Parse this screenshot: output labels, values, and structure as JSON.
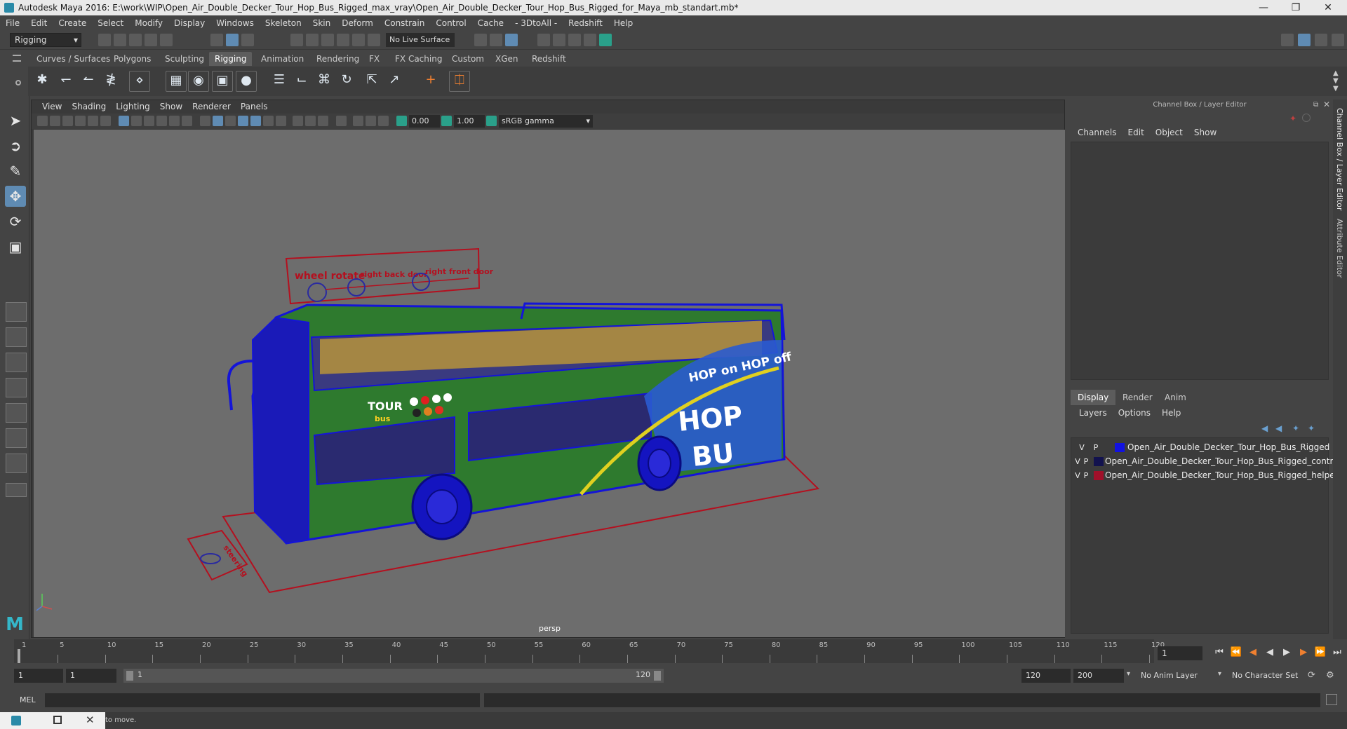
{
  "window": {
    "title": "Autodesk Maya 2016: E:\\work\\WIP\\Open_Air_Double_Decker_Tour_Hop_Bus_Rigged_max_vray\\Open_Air_Double_Decker_Tour_Hop_Bus_Rigged_for_Maya_mb_standart.mb*",
    "minimize": "—",
    "restore": "❐",
    "close": "✕"
  },
  "menubar": [
    "File",
    "Edit",
    "Create",
    "Select",
    "Modify",
    "Display",
    "Windows",
    "Skeleton",
    "Skin",
    "Deform",
    "Constrain",
    "Control",
    "Cache",
    "- 3DtoAll -",
    "Redshift",
    "Help"
  ],
  "statusline": {
    "mode": "Rigging",
    "live_surface": "No Live Surface"
  },
  "shelf_tabs": [
    "Curves / Surfaces",
    "Polygons",
    "Sculpting",
    "Rigging",
    "Animation",
    "Rendering",
    "FX",
    "FX Caching",
    "Custom",
    "XGen",
    "Redshift"
  ],
  "shelf_active": "Rigging",
  "viewport": {
    "menu": [
      "View",
      "Shading",
      "Lighting",
      "Show",
      "Renderer",
      "Panels"
    ],
    "exposure": "0.00",
    "gamma": "1.00",
    "colorspace": "sRGB gamma",
    "camera": "persp",
    "controls_panel": {
      "wheel_rotate": "wheel rotate",
      "right_back_door": "right back door",
      "right_front_door": "right front door",
      "steering": "steering"
    },
    "bus_text": {
      "slogan": "HOP on HOP off",
      "side_big_top": "HOP",
      "side_big_bottom": "BU",
      "logo_top": "TOUR",
      "logo_bottom": "bus"
    }
  },
  "channelbox": {
    "title": "Channel Box / Layer Editor",
    "menu": [
      "Channels",
      "Edit",
      "Object",
      "Show"
    ],
    "layer_tabs": [
      "Display",
      "Render",
      "Anim"
    ],
    "layer_active": "Display",
    "layer_menu": [
      "Layers",
      "Options",
      "Help"
    ],
    "layers": [
      {
        "v": "V",
        "p": "P",
        "color": "#1212e0",
        "name": "Open_Air_Double_Decker_Tour_Hop_Bus_Rigged"
      },
      {
        "v": "V",
        "p": "P",
        "color": "#12124e",
        "name": "Open_Air_Double_Decker_Tour_Hop_Bus_Rigged_contro"
      },
      {
        "v": "V",
        "p": "P",
        "color": "#a0102a",
        "name": "Open_Air_Double_Decker_Tour_Hop_Bus_Rigged_helper"
      }
    ],
    "side_tabs": [
      "Channel Box / Layer Editor",
      "Attribute Editor"
    ]
  },
  "timeline": {
    "ticks": [
      "1",
      "5",
      "10",
      "15",
      "20",
      "25",
      "30",
      "35",
      "40",
      "45",
      "50",
      "55",
      "60",
      "65",
      "70",
      "75",
      "80",
      "85",
      "90",
      "95",
      "100",
      "105",
      "110",
      "115",
      "120"
    ],
    "current_frame": "1"
  },
  "range": {
    "start": "1",
    "playback_start": "1",
    "inner_start": "1",
    "inner_end": "120",
    "playback_end": "120",
    "end": "200",
    "anim_layer": "No Anim Layer",
    "character_set": "No Character Set"
  },
  "cmdline": {
    "label": "MEL"
  },
  "help": {
    "text": "to move."
  }
}
